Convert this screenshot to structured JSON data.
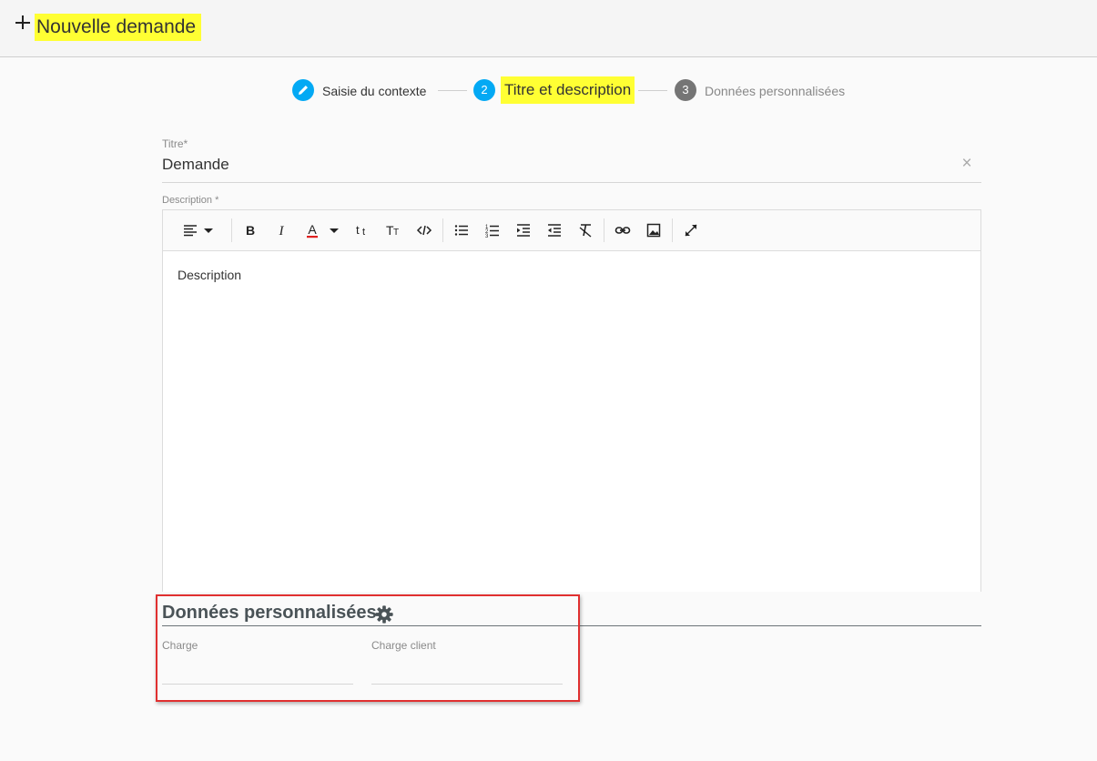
{
  "header": {
    "title": "Nouvelle demande",
    "icon": "plus-icon"
  },
  "stepper": {
    "steps": [
      {
        "label": "Saisie du contexte",
        "state": "done",
        "icon": "pencil-icon"
      },
      {
        "number": "2",
        "label": "Titre et description",
        "state": "active"
      },
      {
        "number": "3",
        "label": "Données personnalisées",
        "state": "todo"
      }
    ]
  },
  "form": {
    "titre": {
      "label": "Titre*",
      "value": "Demande"
    },
    "description": {
      "label": "Description *",
      "content": "Description",
      "toolbar": [
        "align-left-icon",
        "caret-down-icon",
        "bold-icon",
        "italic-icon",
        "text-color-icon",
        "caret-down-icon",
        "subscript-text-icon",
        "text-size-icon",
        "code-icon",
        "bullet-list-icon",
        "numbered-list-icon",
        "indent-icon",
        "outdent-icon",
        "clear-format-icon",
        "link-icon",
        "image-icon",
        "fullscreen-icon"
      ]
    }
  },
  "custom_data": {
    "title": "Données personnalisées",
    "fields": [
      {
        "label": "Charge",
        "value": ""
      },
      {
        "label": "Charge client",
        "value": ""
      }
    ]
  },
  "colors": {
    "accent": "#03a9f4",
    "highlight": "#ffff33",
    "inactive_step": "#757575",
    "annotation": "#e03030"
  }
}
